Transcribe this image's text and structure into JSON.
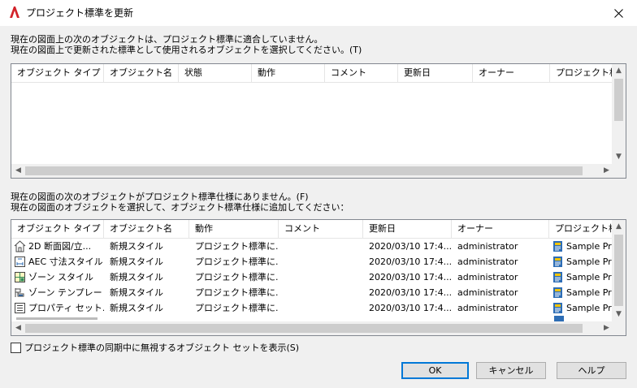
{
  "window": {
    "title": "プロジェクト標準を更新",
    "close_glyph": "✕"
  },
  "section1": {
    "line1": "現在の図面上の次のオブジェクトは、プロジェクト標準に適合していません。",
    "line2": "現在の図面上で更新された標準として使用されるオブジェクトを選択してください。(T)",
    "columns": [
      "オブジェクト タイプ",
      "オブジェクト名",
      "状態",
      "動作",
      "コメント",
      "更新日",
      "オーナー",
      "プロジェクト標..."
    ]
  },
  "section2": {
    "line1": "現在の図面の次のオブジェクトがプロジェクト標準仕様にありません。(F)",
    "line2": "現在の図面のオブジェクトを選択して、オブジェクト標準仕様に追加してください：",
    "columns": [
      "オブジェクト タイプ",
      "オブジェクト名",
      "動作",
      "コメント",
      "更新日",
      "オーナー",
      "プロジェクト標準"
    ],
    "rows": [
      {
        "icon": "2d-section-icon",
        "type": "2D 断面図/立...",
        "name": "新規スタイル",
        "action": "プロジェクト標準に...",
        "comment": "",
        "date": "2020/03/10 17:4...",
        "owner": "administrator",
        "standard": "Sample Pro"
      },
      {
        "icon": "aec-dimension-icon",
        "type": "AEC 寸法スタイル",
        "name": "新規スタイル",
        "action": "プロジェクト標準に...",
        "comment": "",
        "date": "2020/03/10 17:4...",
        "owner": "administrator",
        "standard": "Sample Pro"
      },
      {
        "icon": "zone-style-icon",
        "type": "ゾーン スタイル",
        "name": "新規スタイル",
        "action": "プロジェクト標準に...",
        "comment": "",
        "date": "2020/03/10 17:4...",
        "owner": "administrator",
        "standard": "Sample Pro"
      },
      {
        "icon": "zone-template-icon",
        "type": "ゾーン テンプレート",
        "name": "新規スタイル",
        "action": "プロジェクト標準に...",
        "comment": "",
        "date": "2020/03/10 17:4...",
        "owner": "administrator",
        "standard": "Sample Pro"
      },
      {
        "icon": "property-set-icon",
        "type": "プロパティ セット...",
        "name": "新規スタイル",
        "action": "プロジェクト標準に...",
        "comment": "",
        "date": "2020/03/10 17:4...",
        "owner": "administrator",
        "standard": "Sample Pro"
      }
    ]
  },
  "checkbox_label": "プロジェクト標準の同期中に無視するオブジェクト セットを表示(S)",
  "buttons": {
    "ok": "OK",
    "cancel": "キャンセル",
    "help": "ヘルプ"
  },
  "colors": {
    "accent": "#0078d7",
    "logo_red": "#d2232a"
  }
}
